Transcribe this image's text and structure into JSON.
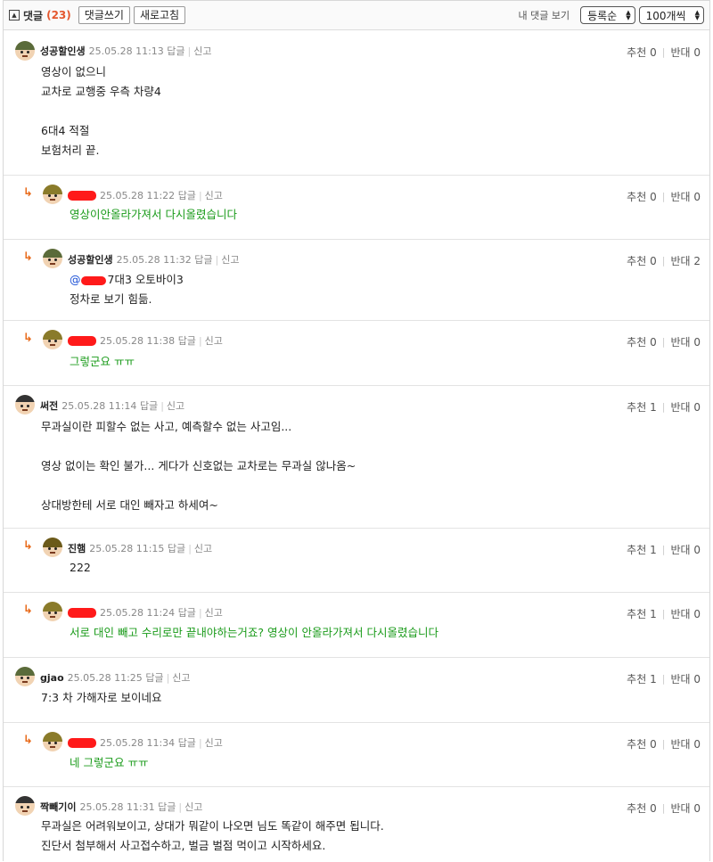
{
  "toolbar": {
    "toggle_icon": "▲",
    "comments_label": "댓글",
    "count": "(23)",
    "write_label": "댓글쓰기",
    "refresh_label": "새로고침",
    "my_comments_label": "내 댓글 보기",
    "sort_value": "등록순",
    "per_page_value": "100개씩"
  },
  "labels": {
    "reply": "답글",
    "report": "신고",
    "up": "추천",
    "down": "반대"
  },
  "comments": [
    {
      "nick": "성공할인생",
      "time": "25.05.28 11:13",
      "up": "0",
      "down": "0",
      "lines": [
        "영상이 없으니",
        "교차로 교행중 우측 차량4",
        "",
        "6대4 적절",
        "보험처리 끝."
      ]
    },
    {
      "nick": "",
      "time": "25.05.28 11:22",
      "up": "0",
      "down": "0",
      "lines": [
        "영상이안올라가져서 다시올렸습니다"
      ]
    },
    {
      "nick": "성공할인생",
      "time": "25.05.28 11:32",
      "up": "0",
      "down": "2",
      "mention": "@",
      "lines": [
        "7대3 오토바이3",
        "정차로 보기 힘듦."
      ]
    },
    {
      "nick": "",
      "time": "25.05.28 11:38",
      "up": "0",
      "down": "0",
      "lines": [
        "그렇군요 ㅠㅠ"
      ]
    },
    {
      "nick": "써전",
      "time": "25.05.28 11:14",
      "up": "1",
      "down": "0",
      "lines": [
        "무과실이란 피할수 없는 사고, 예측할수 없는 사고임...",
        "",
        "영상 없이는 확인 불가... 게다가 신호없는 교차로는 무과실 않나옴~",
        "",
        "상대방한테 서로 대인 빼자고 하세여~"
      ]
    },
    {
      "nick": "진햄",
      "time": "25.05.28 11:15",
      "up": "1",
      "down": "0",
      "lines": [
        "222"
      ]
    },
    {
      "nick": "",
      "time": "25.05.28 11:24",
      "up": "1",
      "down": "0",
      "lines": [
        "서로 대인 빼고 수리로만 끝내야하는거죠? 영상이 안올라가져서 다시올렸습니다"
      ]
    },
    {
      "nick": "gjao",
      "time": "25.05.28 11:25",
      "up": "1",
      "down": "0",
      "lines": [
        "7:3 차 가해자로 보이네요"
      ]
    },
    {
      "nick": "",
      "time": "25.05.28 11:34",
      "up": "0",
      "down": "0",
      "lines": [
        "네 그렇군요 ㅠㅠ"
      ]
    },
    {
      "nick": "짝빼기이",
      "time": "25.05.28 11:31",
      "up": "0",
      "down": "0",
      "lines": [
        "무과실은 어려워보이고, 상대가 뭐같이 나오면 님도 똑같이 해주면 됩니다.",
        "진단서 첨부해서 사고접수하고, 벌금 벌점 먹이고 시작하세요."
      ]
    }
  ],
  "colors": {
    "accent_count": "#e4572e",
    "reply_text": "#1a9b1a",
    "reply_arrow": "#e86a1a",
    "mention": "#1a4fd6",
    "redaction": "#ff1a1a"
  }
}
